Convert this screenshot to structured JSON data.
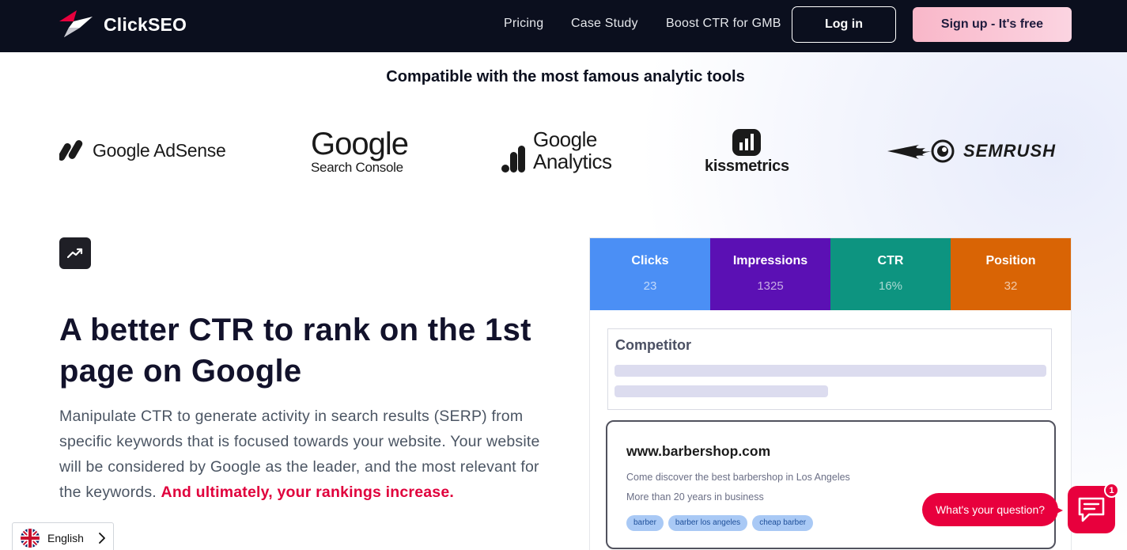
{
  "nav": {
    "brand": "ClickSEO",
    "links": [
      "Pricing",
      "Case Study",
      "Boost CTR for GMB"
    ],
    "login_label": "Log in",
    "signup_label": "Sign up - It's free"
  },
  "compat": {
    "title": "Compatible with the most famous analytic tools",
    "logos": {
      "adsense": "Google AdSense",
      "gsc_big": "Google",
      "gsc_small": "Search Console",
      "ga_top": "Google",
      "ga_bottom": "Analytics",
      "kissmetrics": "kissmetrics",
      "semrush": "SEMRUSH"
    }
  },
  "feature": {
    "icon": "trending-up-icon",
    "headline": "A better CTR to rank on the 1st page on Google",
    "description": "Manipulate CTR to generate activity in search results (SERP) from specific keywords that is focused towards your website. Your website will be considered by Google as the leader, and the most relevant for the keywords.",
    "highlight": "And ultimately, your rankings increase."
  },
  "mockup": {
    "stats": [
      {
        "label": "Clicks",
        "value": "23",
        "color": "#4b8ff5"
      },
      {
        "label": "Impressions",
        "value": "1325",
        "color": "#5b10b4"
      },
      {
        "label": "CTR",
        "value": "16%",
        "color": "#0d9480"
      },
      {
        "label": "Position",
        "value": "32",
        "color": "#d96405"
      }
    ],
    "competitor_title": "Competitor",
    "result": {
      "url": "www.barbershop.com",
      "line1": "Come discover the best barbershop in Los Angeles",
      "line2": "More than 20 years in business",
      "tags": [
        "barber",
        "barber los angeles",
        "cheap barber"
      ]
    }
  },
  "chat": {
    "prompt": "What's your question?",
    "badge_count": "1"
  },
  "language": {
    "current": "English"
  },
  "colors": {
    "nav_bg": "#0b0f1e",
    "accent_red": "#e8003d",
    "highlight_red": "#e0003c"
  }
}
